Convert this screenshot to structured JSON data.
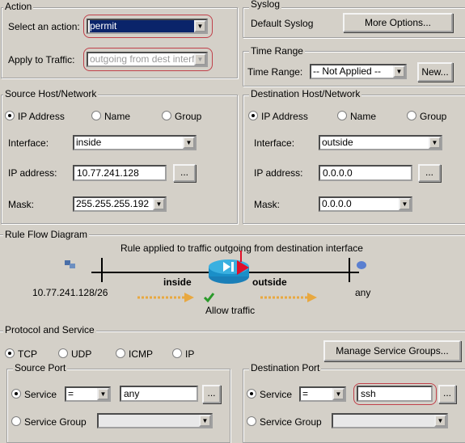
{
  "action": {
    "legend": "Action",
    "select_label": "Select an action:",
    "select_value": "permit",
    "apply_label": "Apply to Traffic:",
    "apply_value": "outgoing from dest interf"
  },
  "syslog": {
    "legend": "Syslog",
    "value": "Default Syslog",
    "more_button": "More Options..."
  },
  "time_range": {
    "legend": "Time Range",
    "label": "Time Range:",
    "value": "-- Not Applied --",
    "new_button": "New..."
  },
  "source": {
    "legend": "Source Host/Network",
    "radios": [
      "IP Address",
      "Name",
      "Group"
    ],
    "interface_label": "Interface:",
    "interface_value": "inside",
    "ip_label": "IP address:",
    "ip_value": "10.77.241.128",
    "browse": "...",
    "mask_label": "Mask:",
    "mask_value": "255.255.255.192"
  },
  "destination": {
    "legend": "Destination Host/Network",
    "radios": [
      "IP Address",
      "Name",
      "Group"
    ],
    "interface_label": "Interface:",
    "interface_value": "outside",
    "ip_label": "IP address:",
    "ip_value": "0.0.0.0",
    "browse": "...",
    "mask_label": "Mask:",
    "mask_value": "0.0.0.0"
  },
  "diagram": {
    "legend": "Rule Flow Diagram",
    "caption": "Rule applied to traffic outgoing from destination interface",
    "source": "10.77.241.128/26",
    "inside": "inside",
    "outside": "outside",
    "dest": "any",
    "status": "Allow traffic"
  },
  "protocol": {
    "legend": "Protocol and Service",
    "radios": [
      "TCP",
      "UDP",
      "ICMP",
      "IP"
    ],
    "manage_button": "Manage Service Groups..."
  },
  "source_port": {
    "legend": "Source Port",
    "service_label": "Service",
    "operator": "=",
    "value": "any",
    "browse": "...",
    "group_label": "Service Group"
  },
  "dest_port": {
    "legend": "Destination Port",
    "service_label": "Service",
    "operator": "=",
    "value": "ssh",
    "browse": "...",
    "group_label": "Service Group"
  }
}
